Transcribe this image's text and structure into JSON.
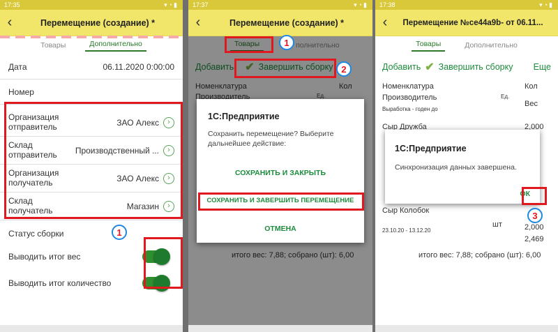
{
  "p1": {
    "time": "17:35",
    "title": "Перемещение (создание) *",
    "tabs": [
      "Товары",
      "Дополнительно"
    ],
    "fields": [
      {
        "label": "Дата",
        "value": "06.11.2020  0:00:00"
      },
      {
        "label": "Номер",
        "value": ""
      }
    ],
    "box_fields": [
      {
        "l1": "Организация",
        "l2": "отправитель",
        "value": "ЗАО Алекс"
      },
      {
        "l1": "Склад",
        "l2": "отправитель",
        "value": "Производственный ..."
      },
      {
        "l1": "Организация",
        "l2": "получатель",
        "value": "ЗАО Алекс"
      },
      {
        "l1": "Склад",
        "l2": "получатель",
        "value": "Магазин"
      }
    ],
    "status_label": "Статус сборки",
    "toggle1": "Выводить итог вес",
    "toggle2": "Выводить итог количество",
    "marker": "1"
  },
  "p2": {
    "time": "17:37",
    "title": "Перемещение (создание) *",
    "tabs": [
      "Товары",
      "Дополнительно"
    ],
    "tab2_visible": "полнительно",
    "add": "Добавить",
    "finish": "Завершить сборку",
    "marker1": "1",
    "marker2": "2",
    "table_h1": "Номенклатура",
    "table_h2": "Производитель",
    "col_ed": "Ед.",
    "col_kol": "Кол",
    "dialog": {
      "title": "1С:Предприятие",
      "text": "Сохранить перемещение? Выберите дальнейшее действие:",
      "btn1": "СОХРАНИТЬ И ЗАКРЫТЬ",
      "btn2": "СОХРАНИТЬ И ЗАВЕРШИТЬ ПЕРЕМЕЩЕНИЕ",
      "btn3": "ОТМЕНА"
    },
    "footer": "итого вес: 7,88; собрано (шт): 6,00"
  },
  "p3": {
    "time": "17:38",
    "title": "Перемещение №ce44a9b- от 06.11...",
    "tabs": [
      "Товары",
      "Дополнительно"
    ],
    "add": "Добавить",
    "finish": "Завершить сборку",
    "more": "Еще",
    "table_h1": "Номенклатура",
    "table_h2": "Производитель",
    "table_h3": "Выработка - годен до",
    "col_ed": "Ед.",
    "col_kol": "Кол",
    "col_ves": "Вес",
    "item1": "Сыр Дружба",
    "item1_val": "2,000",
    "item2": "Сыр Колобок",
    "item2_unit": "шт",
    "item2_dates": "23.10.20 - 13.12.20",
    "item2_val": "2,469",
    "col_ves2": "2,000",
    "dialog": {
      "title": "1С:Предприятие",
      "text": "Синхронизация данных завершена.",
      "ok": "ОК"
    },
    "marker": "3",
    "footer": "итого вес: 7,88; собрано (шт): 6,00"
  }
}
